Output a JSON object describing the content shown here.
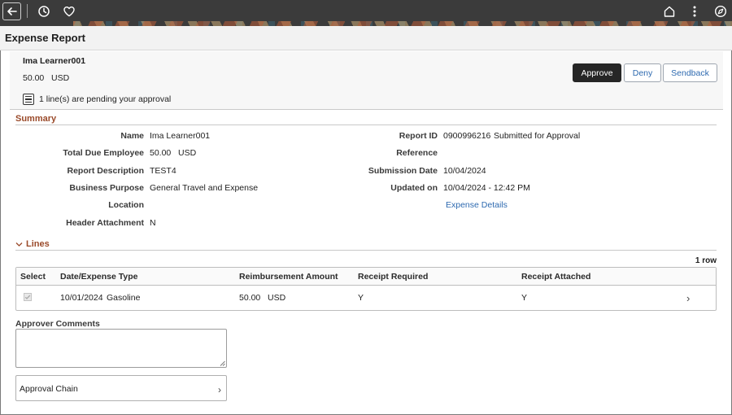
{
  "banner": {
    "icons": [
      "back-arrow-icon",
      "history-clock-icon",
      "favorite-heart-icon",
      "home-icon",
      "more-vertical-icon",
      "navigator-compass-icon"
    ]
  },
  "page": {
    "title": "Expense Report"
  },
  "header": {
    "employee_name": "Ima Learner001",
    "amount": "50.00   USD",
    "pending_text": "1 line(s) are pending your approval",
    "buttons": {
      "approve": "Approve",
      "deny": "Deny",
      "sendback": "Sendback"
    }
  },
  "summary": {
    "heading": "Summary",
    "name_label": "Name",
    "name_value": "Ima Learner001",
    "total_due_label": "Total Due Employee",
    "total_due_value": "50.00   USD",
    "report_desc_label": "Report Description",
    "report_desc_value": "TEST4",
    "business_purpose_label": "Business Purpose",
    "business_purpose_value": "General Travel and Expense",
    "location_label": "Location",
    "location_value": "",
    "header_attachment_label": "Header Attachment",
    "header_attachment_value": "N",
    "report_id_label": "Report ID",
    "report_id_value": "0900996216",
    "report_status": "Submitted for Approval",
    "reference_label": "Reference",
    "reference_value": "",
    "submission_date_label": "Submission Date",
    "submission_date_value": "10/04/2024",
    "updated_on_label": "Updated on",
    "updated_on_value": "10/04/2024 - 12:42 PM",
    "expense_details_link": "Expense Details"
  },
  "lines": {
    "heading": "Lines",
    "row_count": "1 row",
    "columns": [
      "Select",
      "Date/Expense Type",
      "Reimbursement Amount",
      "Receipt Required",
      "Receipt Attached"
    ],
    "rows": [
      {
        "selected": true,
        "date": "10/01/2024",
        "expense_type": "Gasoline",
        "amount": "50.00   USD",
        "receipt_required": "Y",
        "receipt_attached": "Y"
      }
    ]
  },
  "comments": {
    "label": "Approver Comments",
    "value": ""
  },
  "approval_chain": {
    "label": "Approval Chain"
  },
  "colors": {
    "accent_heading": "#9a4a2a",
    "link": "#2e6ab0",
    "primary_button": "#262626",
    "banner": "#3b3b3b"
  }
}
